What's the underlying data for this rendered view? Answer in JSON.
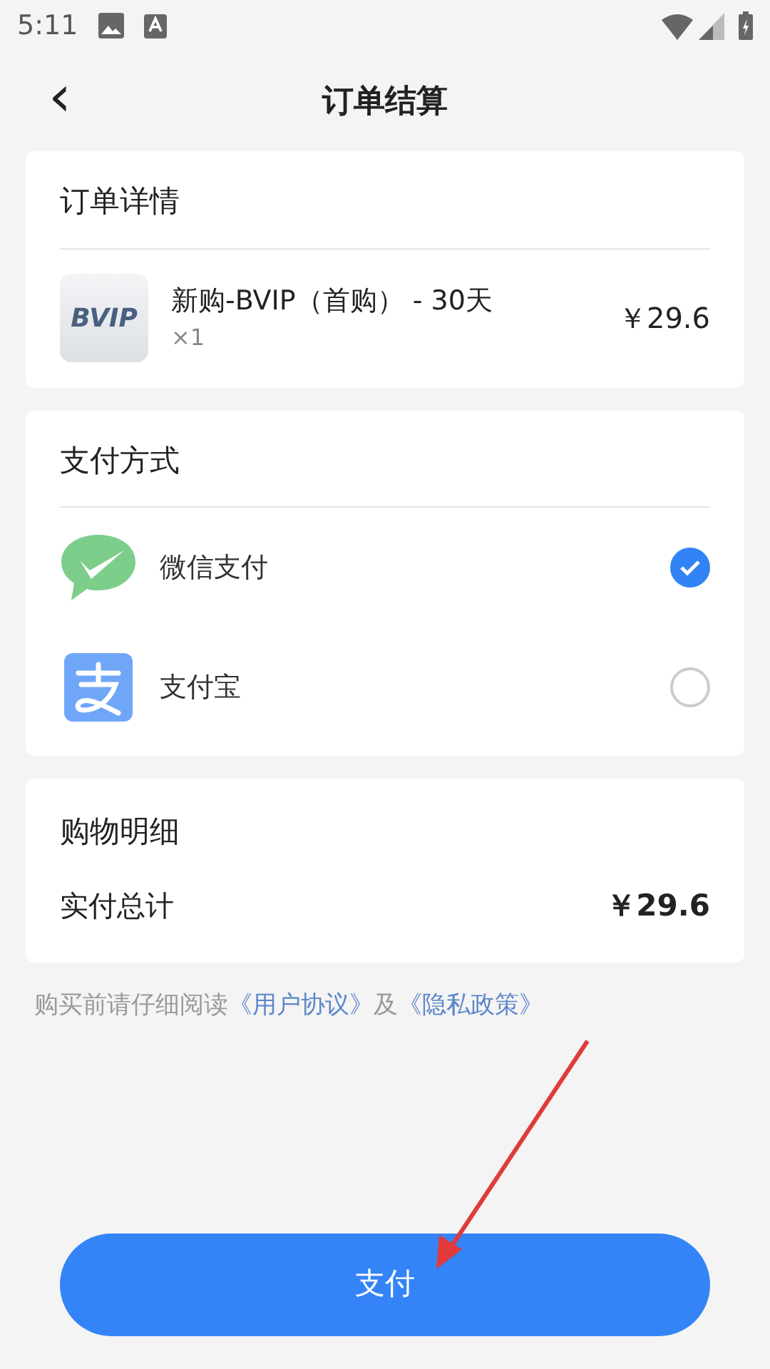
{
  "status_bar": {
    "time": "5:11"
  },
  "header": {
    "back": "‹",
    "title": "订单结算"
  },
  "order": {
    "heading": "订单详情",
    "product": {
      "logo": "BVIP",
      "name": "新购-BVIP（首购） - 30天",
      "quantity": "×1",
      "price": "￥29.6"
    }
  },
  "payment": {
    "heading": "支付方式",
    "methods": [
      {
        "kind": "wechat",
        "label": "微信支付",
        "selected": true
      },
      {
        "kind": "alipay",
        "label": "支付宝",
        "selected": false
      }
    ]
  },
  "summary": {
    "heading": "购物明细",
    "label": "实付总计",
    "total": "￥29.6"
  },
  "agreement": {
    "text": "购买前请仔细阅读",
    "link1": "《用户协议》",
    "joiner": "及",
    "link2": "《隐私政策》"
  },
  "pay_button": "支付",
  "annotation": {
    "kind": "arrow"
  }
}
